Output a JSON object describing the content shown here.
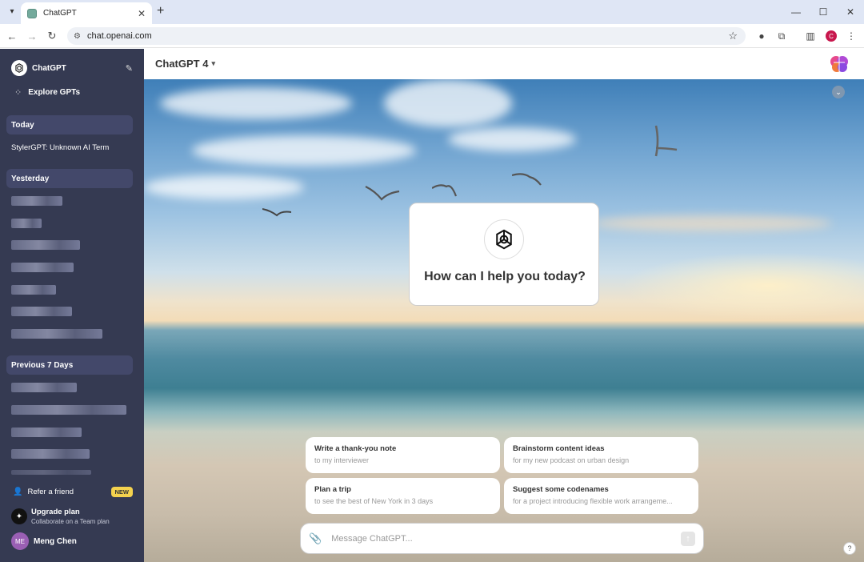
{
  "browser": {
    "tab_title": "ChatGPT",
    "url": "chat.openai.com",
    "profile_initial": "C",
    "icons": {
      "tab_menu": "chevron-down-icon",
      "favicon": "chatgpt-favicon",
      "tab_close": "close-icon",
      "new_tab": "plus-icon",
      "minimize": "minimize-icon",
      "maximize": "maximize-icon",
      "close_window": "close-icon",
      "back": "back-arrow-icon",
      "forward": "forward-arrow-icon",
      "reload": "reload-icon",
      "site_info": "site-info-icon",
      "bookmark": "star-icon",
      "extension_puzzle": "puzzle-icon",
      "side_panel": "side-panel-icon",
      "more": "more-vertical-icon"
    }
  },
  "sidebar": {
    "brand": "ChatGPT",
    "explore": "Explore GPTs",
    "sections": [
      {
        "label": "Today",
        "items": [
          "StylerGPT: Unknown AI Term"
        ]
      },
      {
        "label": "Yesterday",
        "items": []
      },
      {
        "label": "Previous 7 Days",
        "items": []
      }
    ],
    "refer": "Refer a friend",
    "refer_badge": "NEW",
    "upgrade_title": "Upgrade plan",
    "upgrade_sub": "Collaborate on a Team plan",
    "user_initials": "ME",
    "user_name": "Meng Chen",
    "colors": {
      "background": "#353a52",
      "section": "#43486a",
      "badge": "#f4d24e",
      "avatar": "#9a5fb4"
    }
  },
  "main": {
    "model": "ChatGPT 4",
    "greeting": "How can I help you today?",
    "suggestions": [
      {
        "title": "Write a thank-you note",
        "sub": "to my interviewer"
      },
      {
        "title": "Brainstorm content ideas",
        "sub": "for my new podcast on urban design"
      },
      {
        "title": "Plan a trip",
        "sub": "to see the best of New York in 3 days"
      },
      {
        "title": "Suggest some codenames",
        "sub": "for a project introducing flexible work arrangeme..."
      }
    ],
    "composer_placeholder": "Message ChatGPT...",
    "help": "?"
  }
}
